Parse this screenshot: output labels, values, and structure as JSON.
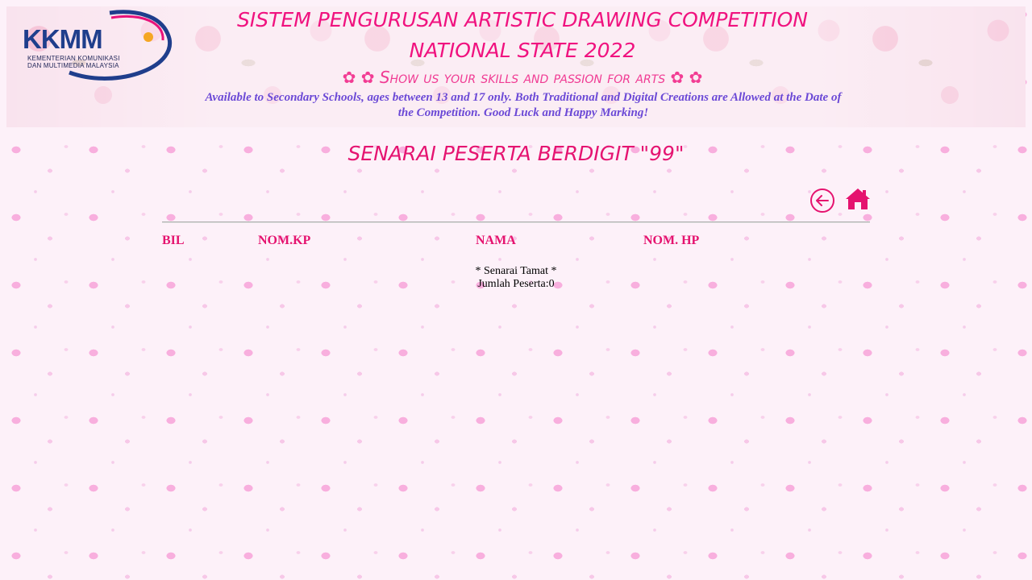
{
  "header": {
    "logo": {
      "text": "KKMM",
      "subtitle_line1": "KEMENTERIAN KOMUNIKASI",
      "subtitle_line2": "DAN MULTIMEDIA MALAYSIA",
      "icon": "kkmm-logo-icon",
      "colors": {
        "navy": "#1f3e8c",
        "orange": "#f5a623",
        "pink": "#e8127a"
      }
    },
    "title_line1": "SISTEM PENGURUSAN ARTISTIC DRAWING COMPETITION",
    "title_line2": "NATIONAL STATE 2022",
    "tagline": "Show us your skills and passion for arts",
    "tagline_flower": "✿",
    "info": "Available to Secondary Schools, ages between 13 and 17 only. Both Traditional and Digital Creations are Allowed at the Date of the Competition. Good Luck and Happy Marking!"
  },
  "main": {
    "heading": "SENARAI PESERTA BERDIGIT \"99\"",
    "nav": {
      "back_icon": "arrow-left-circle-icon",
      "home_icon": "home-icon"
    },
    "table": {
      "columns": [
        "BIL",
        "NOM.KP",
        "NAMA",
        "NOM. HP"
      ],
      "rows": []
    },
    "end_note": "* Senarai Tamat *",
    "total_label": "Jumlah Peserta:0"
  },
  "colors": {
    "accent_pink": "#e5136f",
    "title_pink": "#f0127f",
    "info_purple": "#6b49d6",
    "background": "#fdf1f9"
  }
}
